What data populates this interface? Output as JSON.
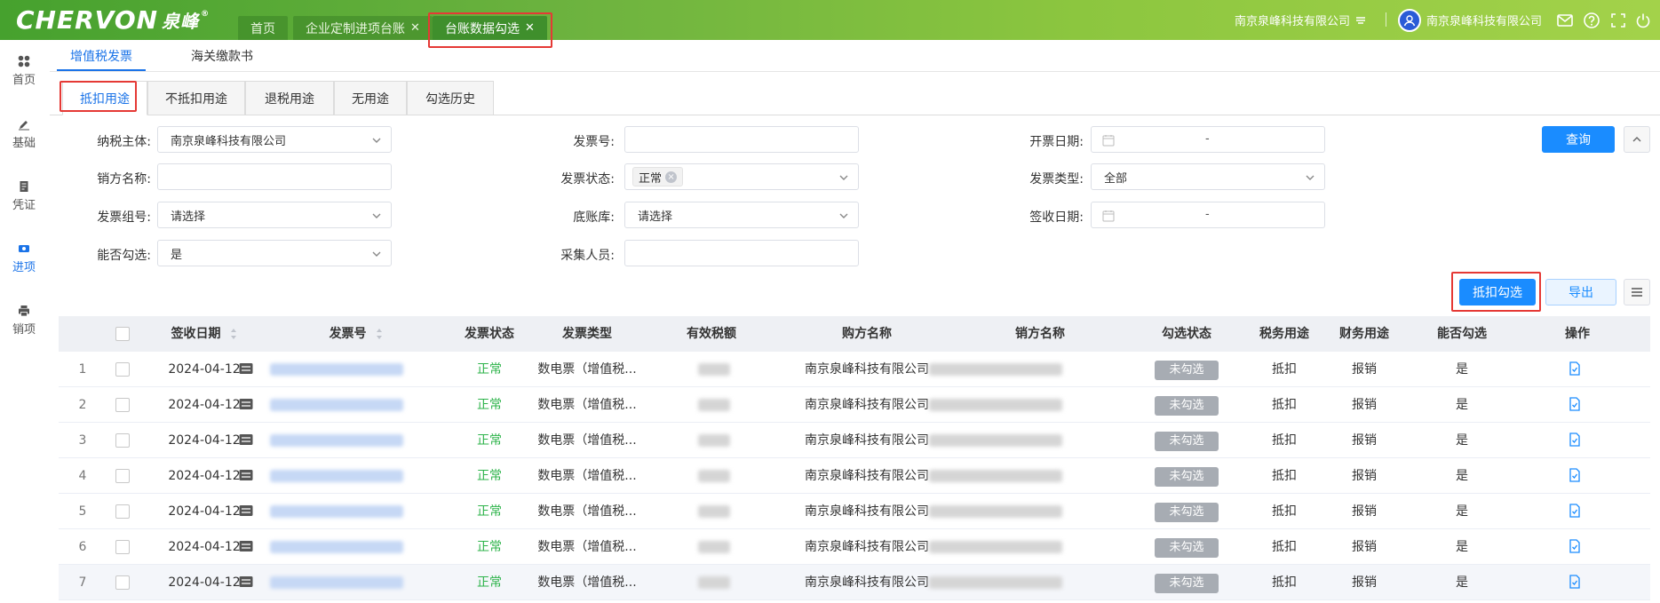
{
  "header": {
    "logo_text": "CHERVON",
    "logo_cn": "泉峰",
    "logo_reg": "®",
    "tabs": [
      {
        "label": "首页",
        "closable": false
      },
      {
        "label": "企业定制进项台账",
        "closable": true
      },
      {
        "label": "台账数据勾选",
        "closable": true,
        "active": true
      }
    ],
    "close_glyph": "✕",
    "org_selector": "南京泉峰科技有限公司",
    "user_name": "南京泉峰科技有限公司"
  },
  "sidebar": {
    "items": [
      {
        "label": "首页",
        "icon": "grid-icon"
      },
      {
        "label": "基础",
        "icon": "pencil-icon"
      },
      {
        "label": "凭证",
        "icon": "document-icon"
      },
      {
        "label": "进项",
        "icon": "ticket-icon",
        "active": true
      },
      {
        "label": "销项",
        "icon": "print-icon"
      }
    ]
  },
  "subtabs": [
    "增值税发票",
    "海关缴款书"
  ],
  "purpose_tabs": [
    "抵扣用途",
    "不抵扣用途",
    "退税用途",
    "无用途",
    "勾选历史"
  ],
  "form": {
    "taxpayer": {
      "label": "纳税主体:",
      "value": "南京泉峰科技有限公司"
    },
    "invoice_no": {
      "label": "发票号:",
      "value": ""
    },
    "issue_date": {
      "label": "开票日期:",
      "sep": "-"
    },
    "seller": {
      "label": "销方名称:",
      "value": ""
    },
    "invoice_status": {
      "label": "发票状态:",
      "tag": "正常"
    },
    "invoice_type": {
      "label": "发票类型:",
      "value": "全部"
    },
    "invoice_group": {
      "label": "发票组号:",
      "placeholder": "请选择"
    },
    "base_ledger": {
      "label": "底账库:",
      "placeholder": "请选择"
    },
    "sign_date": {
      "label": "签收日期:",
      "sep": "-"
    },
    "can_check": {
      "label": "能否勾选:",
      "value": "是"
    },
    "collector": {
      "label": "采集人员:",
      "value": ""
    }
  },
  "buttons": {
    "query": "查询",
    "deduct_check": "抵扣勾选",
    "export": "导出"
  },
  "table": {
    "columns": [
      "签收日期",
      "发票号",
      "发票状态",
      "发票类型",
      "有效税额",
      "购方名称",
      "销方名称",
      "勾选状态",
      "税务用途",
      "财务用途",
      "能否勾选",
      "操作"
    ],
    "rows": [
      {
        "idx": "1",
        "sign_date": "2024-04-12",
        "status": "正常",
        "type": "数电票（增值税...",
        "buyer": "南京泉峰科技有限公司",
        "check_status": "未勾选",
        "tax_use": "抵扣",
        "fin_use": "报销",
        "can_check": "是"
      },
      {
        "idx": "2",
        "sign_date": "2024-04-12",
        "status": "正常",
        "type": "数电票（增值税...",
        "buyer": "南京泉峰科技有限公司",
        "check_status": "未勾选",
        "tax_use": "抵扣",
        "fin_use": "报销",
        "can_check": "是"
      },
      {
        "idx": "3",
        "sign_date": "2024-04-12",
        "status": "正常",
        "type": "数电票（增值税...",
        "buyer": "南京泉峰科技有限公司",
        "check_status": "未勾选",
        "tax_use": "抵扣",
        "fin_use": "报销",
        "can_check": "是"
      },
      {
        "idx": "4",
        "sign_date": "2024-04-12",
        "status": "正常",
        "type": "数电票（增值税...",
        "buyer": "南京泉峰科技有限公司",
        "check_status": "未勾选",
        "tax_use": "抵扣",
        "fin_use": "报销",
        "can_check": "是"
      },
      {
        "idx": "5",
        "sign_date": "2024-04-12",
        "status": "正常",
        "type": "数电票（增值税...",
        "buyer": "南京泉峰科技有限公司",
        "check_status": "未勾选",
        "tax_use": "抵扣",
        "fin_use": "报销",
        "can_check": "是"
      },
      {
        "idx": "6",
        "sign_date": "2024-04-12",
        "status": "正常",
        "type": "数电票（增值税...",
        "buyer": "南京泉峰科技有限公司",
        "check_status": "未勾选",
        "tax_use": "抵扣",
        "fin_use": "报销",
        "can_check": "是"
      },
      {
        "idx": "7",
        "sign_date": "2024-04-12",
        "status": "正常",
        "type": "数电票（增值税...",
        "buyer": "南京泉峰科技有限公司",
        "check_status": "未勾选",
        "tax_use": "抵扣",
        "fin_use": "报销",
        "can_check": "是"
      }
    ]
  },
  "colors": {
    "accent": "#1a8cff",
    "highlight": "#e53935",
    "status_normal": "#2db34a",
    "badge_gray": "#a7acb3"
  }
}
